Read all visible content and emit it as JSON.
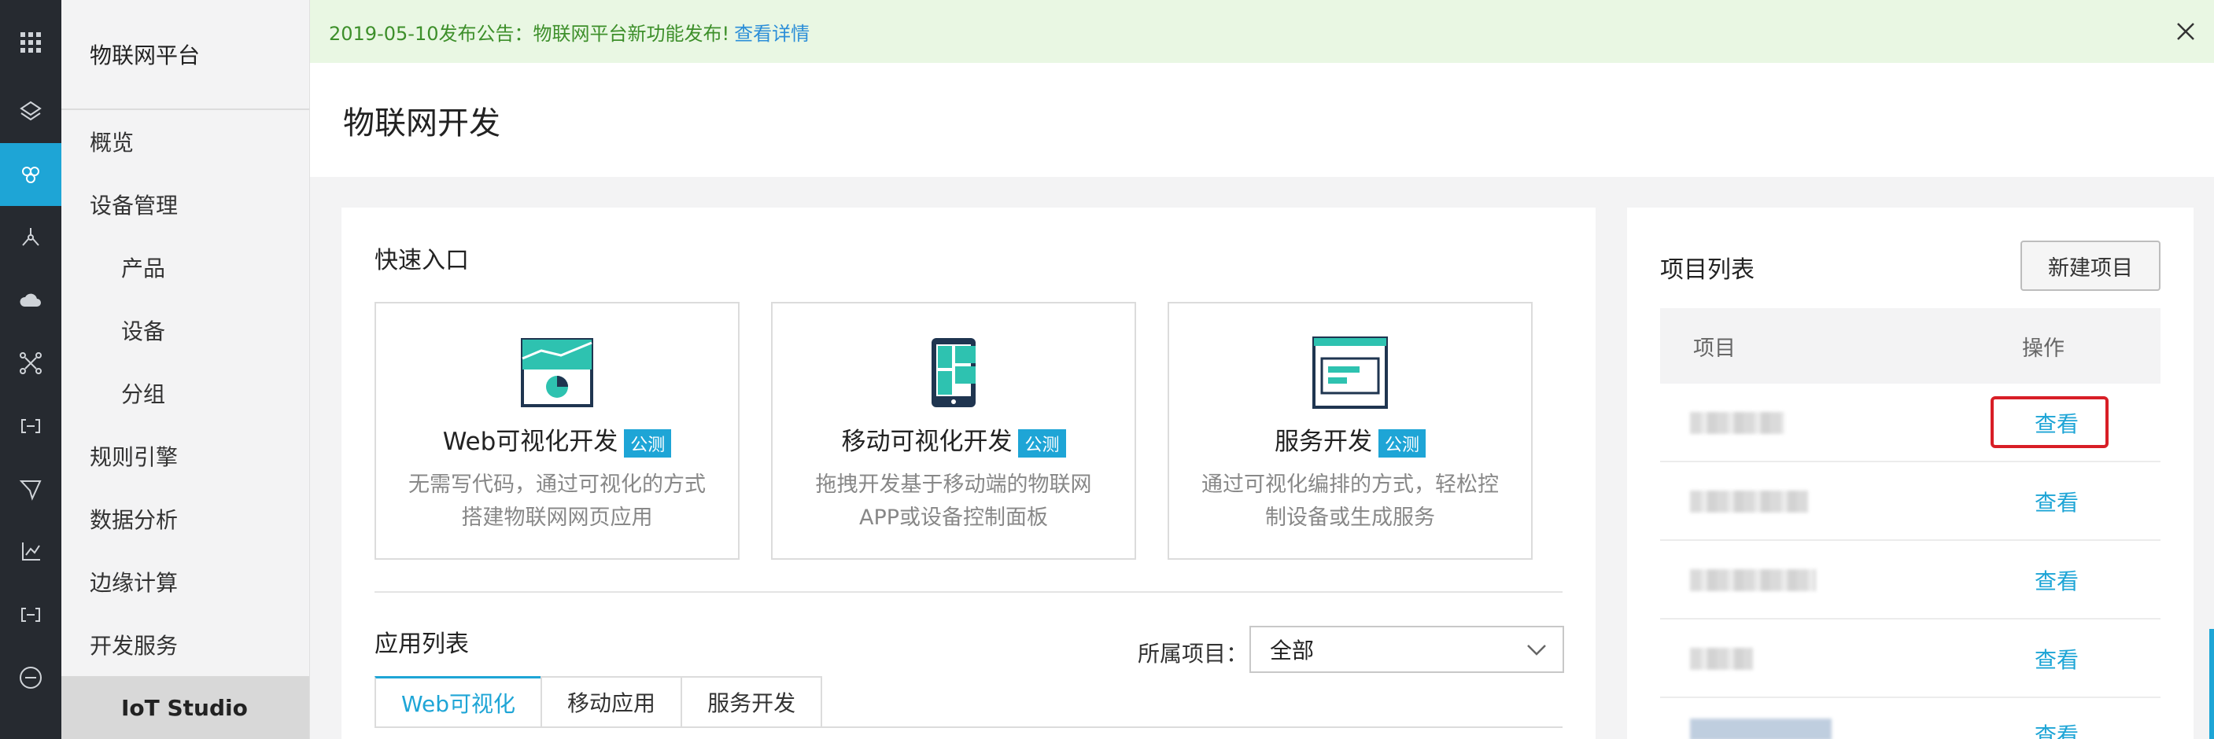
{
  "notice": {
    "text": "2019-05-10发布公告：物联网平台新功能发布!",
    "link": "查看详情"
  },
  "sidebar": {
    "title": "物联网平台",
    "items": [
      {
        "label": "概览"
      },
      {
        "label": "设备管理"
      },
      {
        "label": "产品"
      },
      {
        "label": "设备"
      },
      {
        "label": "分组"
      },
      {
        "label": "规则引擎"
      },
      {
        "label": "数据分析"
      },
      {
        "label": "边缘计算"
      },
      {
        "label": "开发服务"
      },
      {
        "label": "IoT Studio"
      }
    ]
  },
  "page": {
    "title": "物联网开发"
  },
  "quick": {
    "title": "快速入口",
    "tiles": [
      {
        "title": "Web可视化开发",
        "badge": "公测",
        "desc": "无需写代码，通过可视化的方式搭建物联网网页应用",
        "icon": "web-visual-icon"
      },
      {
        "title": "移动可视化开发",
        "badge": "公测",
        "desc": "拖拽开发基于移动端的物联网APP或设备控制面板",
        "icon": "mobile-visual-icon"
      },
      {
        "title": "服务开发",
        "badge": "公测",
        "desc": "通过可视化编排的方式，轻松控制设备或生成服务",
        "icon": "service-dev-icon"
      }
    ]
  },
  "apps": {
    "title": "应用列表",
    "filter_label": "所属项目：",
    "filter_value": "全部",
    "tabs": [
      {
        "label": "Web可视化"
      },
      {
        "label": "移动应用"
      },
      {
        "label": "服务开发"
      }
    ]
  },
  "projects": {
    "title": "项目列表",
    "new_button": "新建项目",
    "col_project": "项目",
    "col_action": "操作",
    "rows": [
      {
        "action": "查看"
      },
      {
        "action": "查看"
      },
      {
        "action": "查看"
      },
      {
        "action": "查看"
      },
      {
        "action": "查看"
      }
    ]
  },
  "colors": {
    "accent": "#1ea5d6",
    "rail": "#262a30",
    "highlight": "#d81e26"
  }
}
